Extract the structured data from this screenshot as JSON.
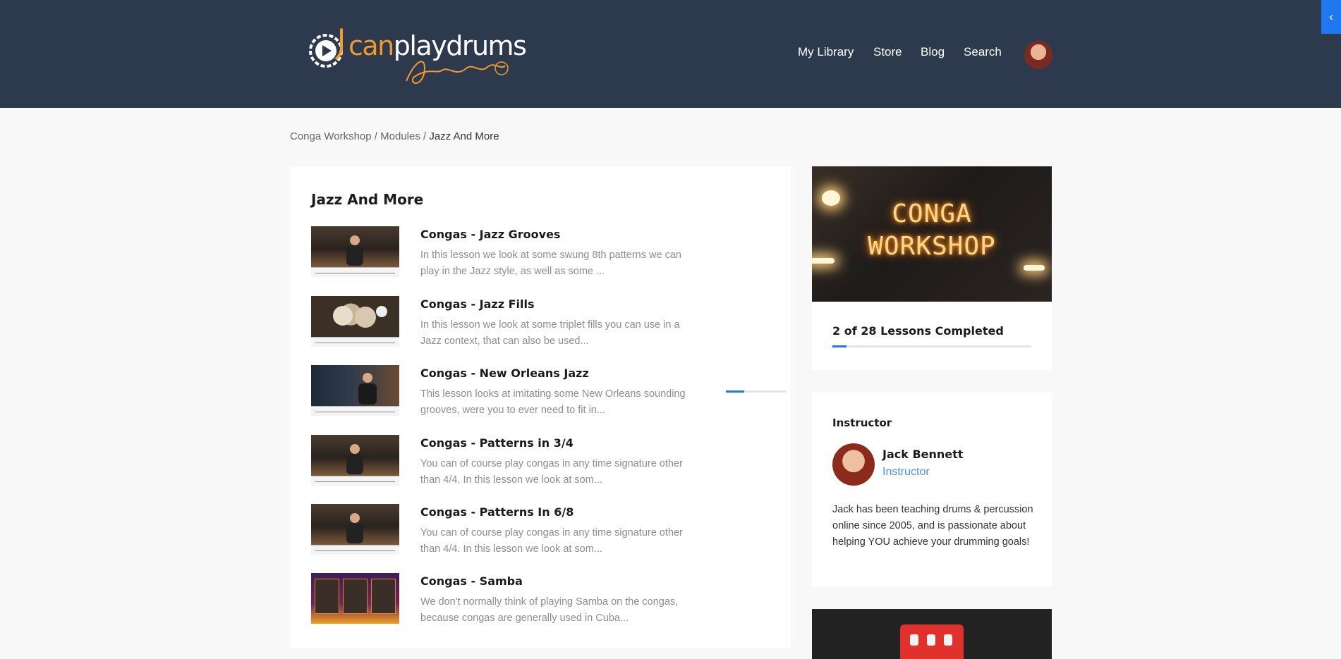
{
  "header": {
    "logo_text_a": "can",
    "logo_text_b": "playdrums",
    "nav": [
      "My Library",
      "Store",
      "Blog",
      "Search"
    ],
    "colors": {
      "background": "#2d3a4d",
      "brand_orange": "#f39a2e",
      "accent_blue": "#1f78f0"
    }
  },
  "breadcrumb": {
    "items": [
      "Conga Workshop",
      "Modules",
      "Jazz And More"
    ],
    "separator": " / "
  },
  "module": {
    "title": "Jazz And More",
    "lessons": [
      {
        "title": "Congas - Jazz Grooves",
        "desc": "In this lesson we look at some swung 8th patterns we can play in the Jazz style, as well as some ..."
      },
      {
        "title": "Congas - Jazz Fills",
        "desc": "In this lesson we look at some triplet fills you can use in a Jazz context, that can also be used..."
      },
      {
        "title": "Congas - New Orleans Jazz",
        "desc": "This lesson looks at imitating some New Orleans sounding grooves, were you to ever need to fit in...",
        "progress": 0.3
      },
      {
        "title": "Congas - Patterns in 3/4",
        "desc": "You can of course play congas in any time signature other than 4/4. In this lesson we look at som..."
      },
      {
        "title": "Congas - Patterns In 6/8",
        "desc": "You can of course play congas in any time signature other than 4/4. In this lesson we look at som..."
      },
      {
        "title": "Congas - Samba",
        "desc": "We don't normally think of playing Samba on the congas, because congas are generally used in Cuba..."
      }
    ]
  },
  "course": {
    "image_lines": [
      "CONGA",
      "WORKSHOP"
    ],
    "progress_label": "2 of 28 Lessons Completed",
    "completed": 2,
    "total": 28
  },
  "instructor": {
    "heading": "Instructor",
    "name": "Jack Bennett",
    "role": "Instructor",
    "bio": "Jack has been teaching drums & percussion online since 2005, and is passionate about helping YOU achieve your drumming goals!"
  },
  "icons": {
    "side_toggle": "chevron-left-icon"
  }
}
